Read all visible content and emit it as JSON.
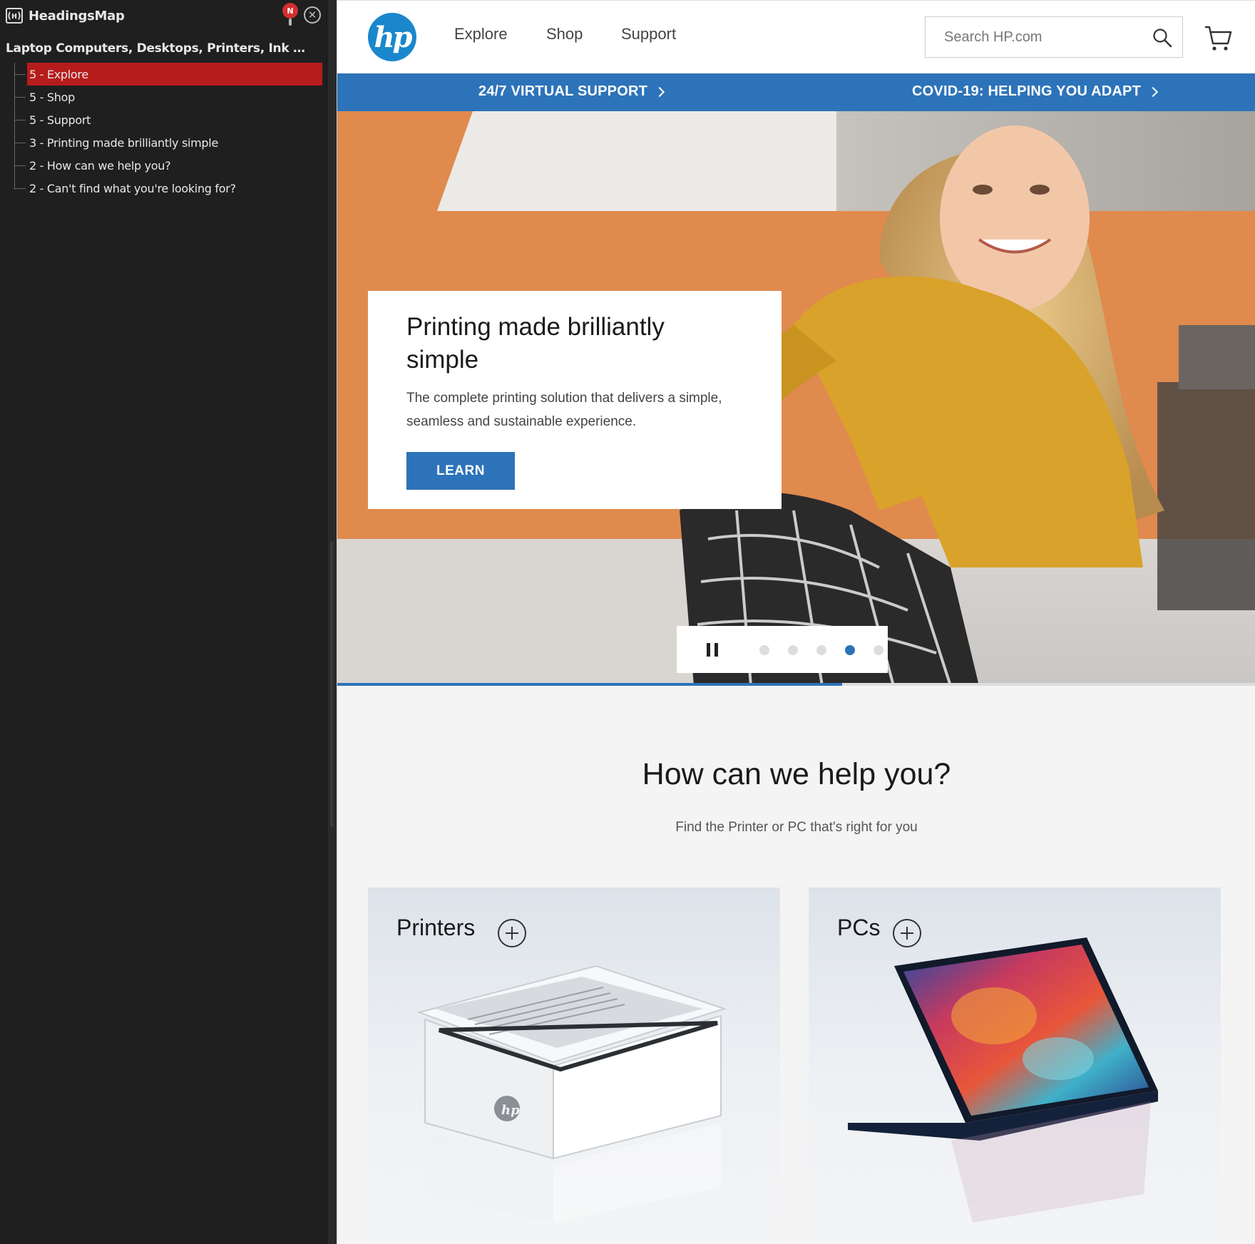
{
  "sidebar": {
    "title": "HeadingsMap",
    "logo_text": "(н)",
    "notif_badge": "N",
    "close_glyph": "✕",
    "document_title": "Laptop Computers, Desktops, Printers, Ink & Toner | HP® Official Site",
    "headings": [
      {
        "label": "5 - Explore",
        "active": true
      },
      {
        "label": "5 - Shop",
        "active": false
      },
      {
        "label": "5 - Support",
        "active": false
      },
      {
        "label": "3 - Printing made brilliantly simple",
        "active": false
      },
      {
        "label": "2 - How can we help you?",
        "active": false
      },
      {
        "label": "2 - Can't find what you're looking for?",
        "active": false
      }
    ]
  },
  "site": {
    "logo_text": "hp",
    "nav": {
      "explore": "Explore",
      "shop": "Shop",
      "support": "Support"
    },
    "search": {
      "placeholder": "Search HP.com",
      "value": ""
    },
    "promo": {
      "left": "24/7 VIRTUAL SUPPORT",
      "right": "COVID-19: HELPING YOU ADAPT"
    },
    "hero": {
      "title": "Printing made brilliantly simple",
      "description": "The complete printing solution that delivers a simple, seamless and sustainable experience.",
      "button": "LEARN",
      "carousel_slides": 5,
      "carousel_active_index": 3,
      "progress_fraction": 0.55
    },
    "help": {
      "title": "How can we help you?",
      "subtitle": "Find the Printer or PC that's right for you",
      "categories": [
        {
          "label": "Printers"
        },
        {
          "label": "PCs"
        }
      ]
    }
  },
  "colors": {
    "hp_blue": "#2d73b9",
    "logo_blue": "#1a87cd",
    "sidebar_bg": "#1f1f1f",
    "active_heading": "#b71c1c",
    "hero_orange": "#e08a4e",
    "sweater_mustard": "#d9a22a"
  }
}
